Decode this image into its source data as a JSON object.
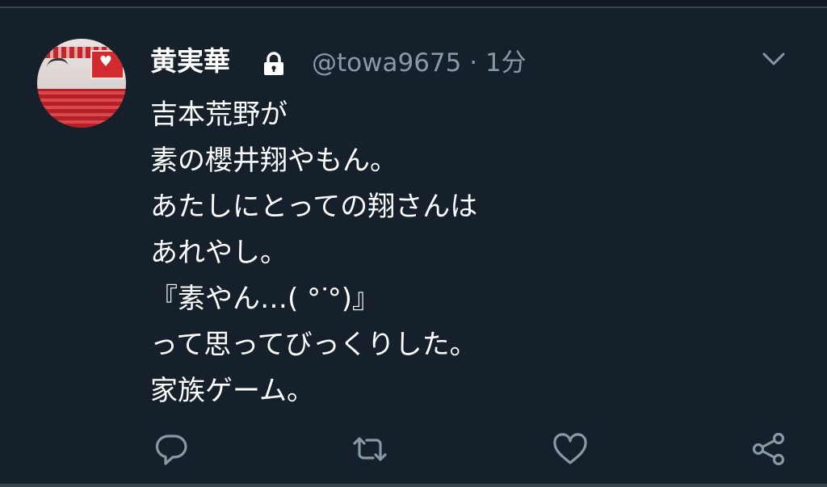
{
  "tweet": {
    "author_name": "黄実華",
    "handle": "@towa9675",
    "separator": "·",
    "time": "1分",
    "lines": [
      "吉本荒野が",
      "素の櫻井翔やもん。",
      "あたしにとっての翔さんは",
      "あれやし。",
      "『素やん…( °ᐝ°)』",
      "って思ってびっくりした。",
      "家族ゲーム。"
    ],
    "icons": {
      "lock": "lock-icon",
      "menu": "chevron-down-icon",
      "reply": "reply-icon",
      "retweet": "retweet-icon",
      "like": "heart-icon",
      "share": "share-icon"
    }
  },
  "colors": {
    "background": "#15202b",
    "text": "#ffffff",
    "muted": "#8899a6",
    "divider": "#38444d"
  }
}
